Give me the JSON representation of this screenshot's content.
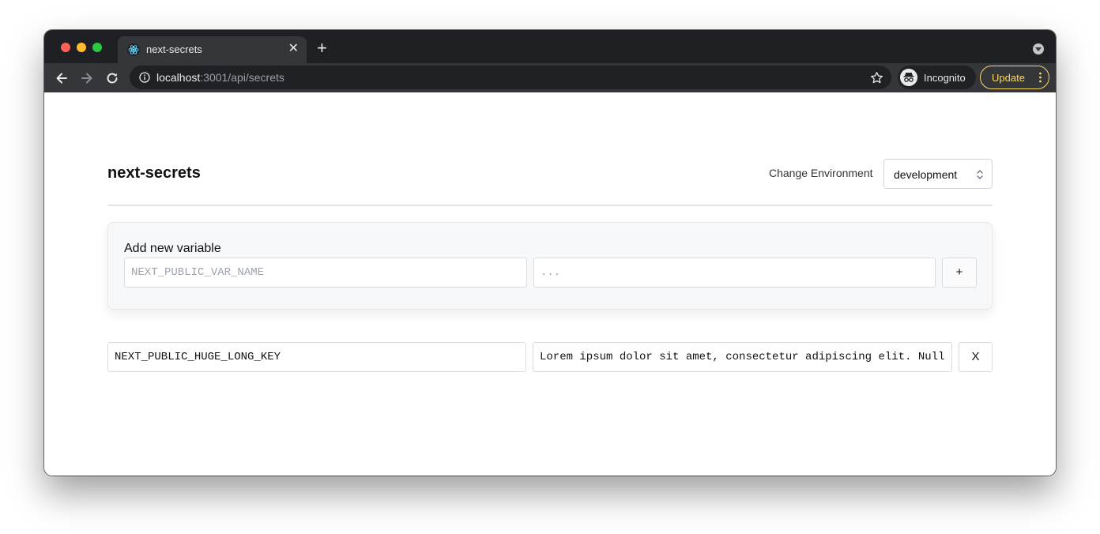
{
  "browser": {
    "tab": {
      "title": "next-secrets",
      "close_label": "✕"
    },
    "new_tab_label": "+",
    "url": {
      "host": "localhost",
      "path": ":3001/api/secrets"
    },
    "profile_label": "Incognito",
    "update_label": "Update",
    "colors": {
      "chrome_dark": "#1f2023",
      "toolbar": "#35363a",
      "update_accent": "#fdd663"
    },
    "icons": [
      "back-arrow-icon",
      "forward-arrow-icon",
      "reload-icon",
      "info-icon",
      "star-icon",
      "incognito-icon",
      "more-vert-icon",
      "react-favicon-icon",
      "tabs-menu-icon"
    ]
  },
  "page": {
    "title": "next-secrets",
    "env_label": "Change Environment",
    "env_selected": "development",
    "add_card": {
      "title": "Add new variable",
      "name_placeholder": "NEXT_PUBLIC_VAR_NAME",
      "value_placeholder": "...",
      "add_button": "+"
    },
    "variables": [
      {
        "name": "NEXT_PUBLIC_HUGE_LONG_KEY",
        "value": "Lorem ipsum dolor sit amet, consectetur adipiscing elit. Null",
        "delete_label": "X"
      }
    ]
  }
}
